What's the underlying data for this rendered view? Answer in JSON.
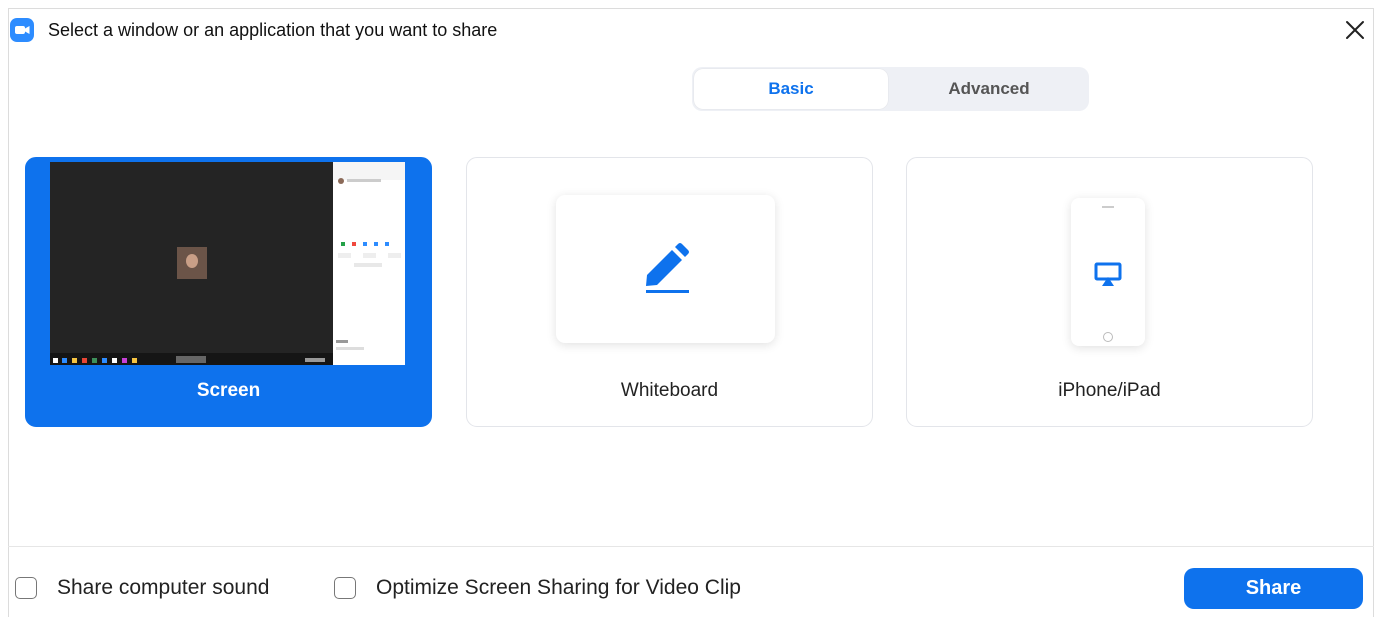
{
  "dialog": {
    "title": "Select a window or an application that you want to share",
    "app_icon": "zoom-camera-icon",
    "close_icon": "close-icon"
  },
  "tabs": [
    {
      "label": "Basic",
      "selected": true
    },
    {
      "label": "Advanced",
      "selected": false
    }
  ],
  "options": [
    {
      "label": "Screen",
      "icon": "screen-thumbnail",
      "selected": true
    },
    {
      "label": "Whiteboard",
      "icon": "pencil-icon",
      "selected": false
    },
    {
      "label": "iPhone/iPad",
      "icon": "airplay-icon",
      "selected": false
    }
  ],
  "footer": {
    "share_sound": "Share computer sound",
    "optimize_video": "Optimize Screen Sharing for Video Clip",
    "share_button": "Share"
  },
  "colors": {
    "accent": "#0e72ed",
    "zoom_blue": "#2d8cff"
  }
}
